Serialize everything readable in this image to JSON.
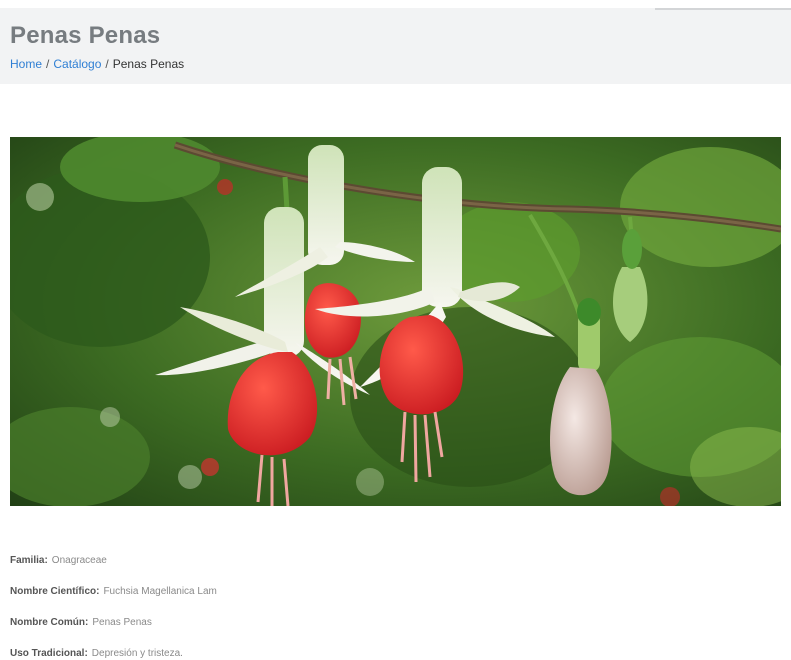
{
  "header": {
    "title": "Penas Penas",
    "breadcrumb": {
      "home": "Home",
      "separator": "/",
      "catalog": "Catálogo",
      "current": "Penas Penas"
    }
  },
  "image": {
    "subject": "flower-photo"
  },
  "details": [
    {
      "label": "Familia:",
      "value": "Onagraceae"
    },
    {
      "label": "Nombre Científico:",
      "value": "Fuchsia Magellanica Lam"
    },
    {
      "label": "Nombre Común:",
      "value": "Penas Penas"
    },
    {
      "label": "Uso Tradicional:",
      "value": "Depresión y tristeza."
    }
  ],
  "colors": {
    "header_bg": "#f2f3f4",
    "title": "#777c80",
    "link": "#2f7fd4",
    "petal_red": "#e8262c",
    "sepal_white": "#f3f4ec",
    "leaf_green": "#3e8a2c"
  }
}
